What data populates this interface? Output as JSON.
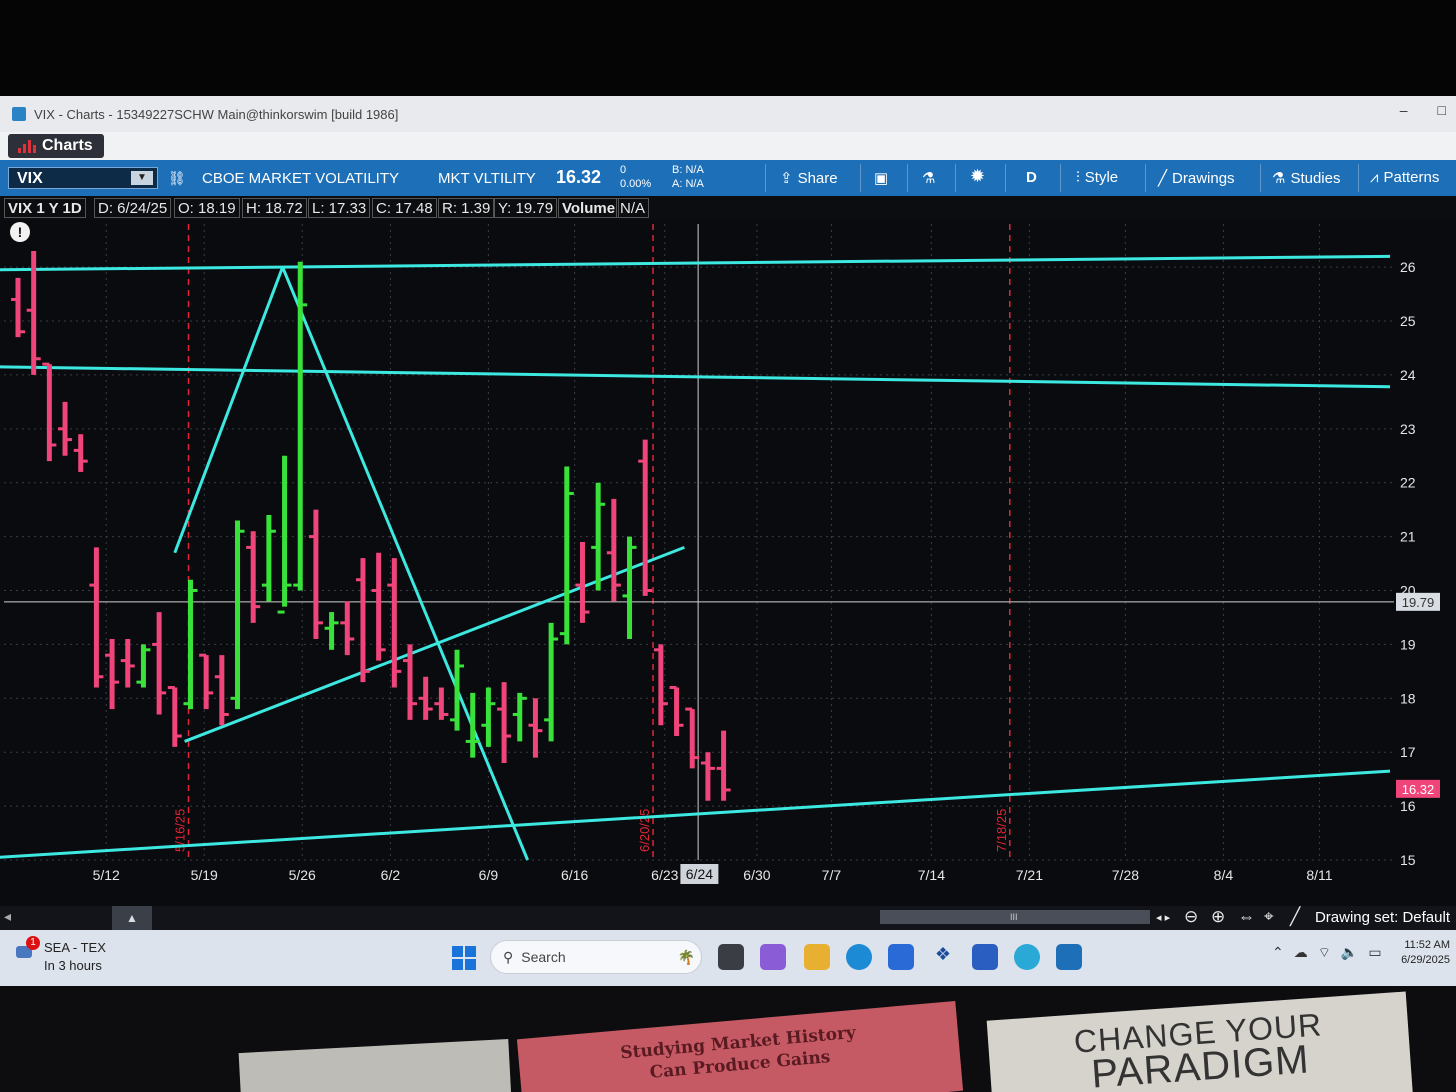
{
  "window": {
    "title": "VIX - Charts - 15349227SCHW Main@thinkorswim [build 1986]",
    "tab_label": "Charts"
  },
  "toolbar": {
    "symbol": "VIX",
    "description": "CBOE MARKET VOLATILITY",
    "exchange": "MKT VLTILITY",
    "last_price": "16.32",
    "change": "0",
    "change_pct": "0.00%",
    "bid": "B: N/A",
    "ask": "A: N/A",
    "share_label": "Share",
    "aggregation": "D",
    "style_label": "Style",
    "drawings_label": "Drawings",
    "studies_label": "Studies",
    "patterns_label": "Patterns"
  },
  "info_row": {
    "timeframe": "VIX 1 Y 1D",
    "date": "D: 6/24/25",
    "open": "O: 18.19",
    "high": "H: 18.72",
    "low": "L: 17.33",
    "close": "C: 17.48",
    "range": "R: 1.39",
    "y": "Y: 19.79",
    "volume_label": "Volume",
    "volume_value": "N/A"
  },
  "chart_data": {
    "type": "bar",
    "title": "",
    "ylim": [
      15,
      26.8
    ],
    "y_ticks": [
      "15",
      "16",
      "17",
      "18",
      "19",
      "20",
      "21",
      "22",
      "23",
      "24",
      "25",
      "26"
    ],
    "x_ticks": [
      "5/12",
      "5/19",
      "5/26",
      "6/2",
      "6/9",
      "6/16",
      "6/23",
      "6/24",
      "6/30",
      "7/7",
      "7/14",
      "7/21",
      "7/28",
      "8/4",
      "8/11"
    ],
    "cursor_price_label": "19.79",
    "last_price_label": "16.32",
    "event_markers": [
      "5/16/25",
      "6/20/25",
      "7/18/25"
    ],
    "colors": {
      "up": "#39e23a",
      "down": "#f0457a",
      "trendline": "#3ce8e0",
      "marker": "#e02535"
    },
    "bars": [
      {
        "o": 25.4,
        "h": 25.8,
        "l": 24.7,
        "c": 24.8
      },
      {
        "o": 25.2,
        "h": 26.3,
        "l": 24.0,
        "c": 24.3
      },
      {
        "o": 24.2,
        "h": 24.2,
        "l": 22.4,
        "c": 22.7
      },
      {
        "o": 23.0,
        "h": 23.5,
        "l": 22.5,
        "c": 22.8
      },
      {
        "o": 22.6,
        "h": 22.9,
        "l": 22.2,
        "c": 22.4
      },
      {
        "o": 20.1,
        "h": 20.8,
        "l": 18.2,
        "c": 18.4
      },
      {
        "o": 18.8,
        "h": 19.1,
        "l": 17.8,
        "c": 18.3
      },
      {
        "o": 18.7,
        "h": 19.1,
        "l": 18.2,
        "c": 18.6
      },
      {
        "o": 18.3,
        "h": 19.0,
        "l": 18.2,
        "c": 18.9
      },
      {
        "o": 19.0,
        "h": 19.6,
        "l": 17.7,
        "c": 18.1
      },
      {
        "o": 18.2,
        "h": 18.2,
        "l": 17.1,
        "c": 17.3
      },
      {
        "o": 17.9,
        "h": 20.2,
        "l": 17.8,
        "c": 20.0
      },
      {
        "o": 18.8,
        "h": 18.8,
        "l": 17.8,
        "c": 18.1
      },
      {
        "o": 18.4,
        "h": 18.8,
        "l": 17.5,
        "c": 17.7
      },
      {
        "o": 18.0,
        "h": 21.3,
        "l": 17.8,
        "c": 21.1
      },
      {
        "o": 20.8,
        "h": 21.1,
        "l": 19.4,
        "c": 19.7
      },
      {
        "o": 20.1,
        "h": 21.4,
        "l": 19.8,
        "c": 21.1
      },
      {
        "o": 19.6,
        "h": 22.5,
        "l": 19.7,
        "c": 20.1
      },
      {
        "o": 20.1,
        "h": 26.1,
        "l": 20.0,
        "c": 25.3
      },
      {
        "o": 21.0,
        "h": 21.5,
        "l": 19.1,
        "c": 19.4
      },
      {
        "o": 19.3,
        "h": 19.6,
        "l": 18.9,
        "c": 19.4
      },
      {
        "o": 19.4,
        "h": 19.8,
        "l": 18.8,
        "c": 19.1
      },
      {
        "o": 20.2,
        "h": 20.6,
        "l": 18.3,
        "c": 18.5
      },
      {
        "o": 20.0,
        "h": 20.7,
        "l": 18.7,
        "c": 18.9
      },
      {
        "o": 20.1,
        "h": 20.6,
        "l": 18.2,
        "c": 18.5
      },
      {
        "o": 18.7,
        "h": 19.0,
        "l": 17.6,
        "c": 17.9
      },
      {
        "o": 18.0,
        "h": 18.4,
        "l": 17.6,
        "c": 17.8
      },
      {
        "o": 17.9,
        "h": 18.2,
        "l": 17.6,
        "c": 17.7
      },
      {
        "o": 17.6,
        "h": 18.9,
        "l": 17.4,
        "c": 18.6
      },
      {
        "o": 17.2,
        "h": 18.1,
        "l": 16.9,
        "c": 17.2
      },
      {
        "o": 17.5,
        "h": 18.2,
        "l": 17.1,
        "c": 17.9
      },
      {
        "o": 17.8,
        "h": 18.3,
        "l": 16.8,
        "c": 17.3
      },
      {
        "o": 17.7,
        "h": 18.1,
        "l": 17.2,
        "c": 18.0
      },
      {
        "o": 17.5,
        "h": 18.0,
        "l": 16.9,
        "c": 17.4
      },
      {
        "o": 17.6,
        "h": 19.4,
        "l": 17.2,
        "c": 19.1
      },
      {
        "o": 19.2,
        "h": 22.3,
        "l": 19.0,
        "c": 21.8
      },
      {
        "o": 20.1,
        "h": 20.9,
        "l": 19.4,
        "c": 19.6
      },
      {
        "o": 20.8,
        "h": 22.0,
        "l": 20.0,
        "c": 21.6
      },
      {
        "o": 20.7,
        "h": 21.7,
        "l": 19.8,
        "c": 20.1
      },
      {
        "o": 19.9,
        "h": 21.0,
        "l": 19.1,
        "c": 20.8
      },
      {
        "o": 22.4,
        "h": 22.8,
        "l": 19.9,
        "c": 20.0
      },
      {
        "o": 18.9,
        "h": 19.0,
        "l": 17.5,
        "c": 17.9
      },
      {
        "o": 18.2,
        "h": 18.2,
        "l": 17.3,
        "c": 17.5
      },
      {
        "o": 17.8,
        "h": 17.8,
        "l": 16.7,
        "c": 16.9
      },
      {
        "o": 16.8,
        "h": 17.0,
        "l": 16.1,
        "c": 16.7
      },
      {
        "o": 16.7,
        "h": 17.4,
        "l": 16.1,
        "c": 16.3
      }
    ]
  },
  "bottom": {
    "drawing_set": "Drawing set: Default"
  },
  "taskbar": {
    "weather_line1": "SEA - TEX",
    "weather_line2": "In 3 hours",
    "weather_badge": "1",
    "search_placeholder": "Search",
    "time": "11:52 AM",
    "date": "6/29/2025"
  },
  "desk": {
    "book1_line1": "Studying Market History",
    "book1_line2": "Can Produce Gains",
    "book2_line1": "CHANGE YOUR",
    "book2_line2": "PARADIGM"
  }
}
